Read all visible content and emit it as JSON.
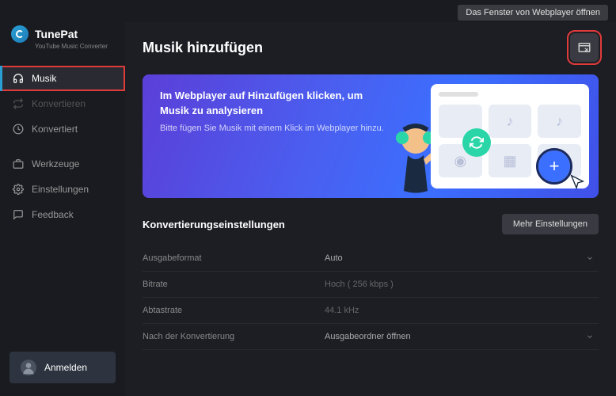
{
  "app": {
    "name": "TunePat",
    "subtitle": "YouTube Music Converter"
  },
  "tooltip": "Das Fenster von Webplayer öffnen",
  "sidebar": {
    "items": [
      {
        "label": "Musik",
        "active": true,
        "highlighted": true
      },
      {
        "label": "Konvertieren",
        "disabled": true
      },
      {
        "label": "Konvertiert"
      },
      {
        "label": "Werkzeuge"
      },
      {
        "label": "Einstellungen"
      },
      {
        "label": "Feedback"
      }
    ],
    "login": "Anmelden"
  },
  "page": {
    "title": "Musik hinzufügen"
  },
  "hero": {
    "title": "Im Webplayer auf Hinzufügen klicken, um Musik zu analysieren",
    "subtitle": "Bitte fügen Sie Musik mit einem Klick im Webplayer hinzu."
  },
  "settings": {
    "title": "Konvertierungseinstellungen",
    "more_button": "Mehr Einstellungen",
    "rows": [
      {
        "label": "Ausgabeformat",
        "value": "Auto",
        "editable": true
      },
      {
        "label": "Bitrate",
        "value": "Hoch ( 256 kbps )",
        "editable": false
      },
      {
        "label": "Abtastrate",
        "value": "44.1 kHz",
        "editable": false
      },
      {
        "label": "Nach der Konvertierung",
        "value": "Ausgabeordner öffnen",
        "editable": true
      }
    ]
  }
}
